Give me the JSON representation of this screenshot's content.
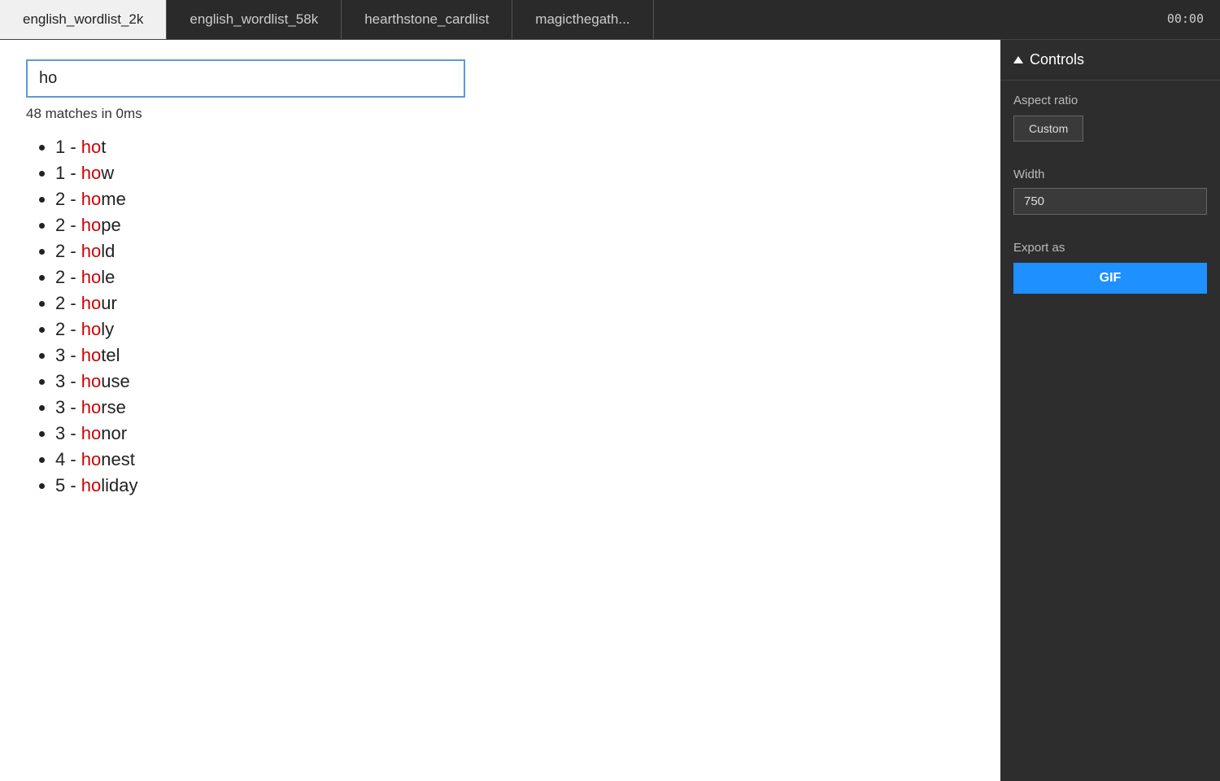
{
  "timer": "00:00",
  "tabs": [
    {
      "id": "tab-wordlist-2k",
      "label": "english_wordlist_2k",
      "active": true
    },
    {
      "id": "tab-wordlist-58k",
      "label": "english_wordlist_58k",
      "active": false
    },
    {
      "id": "tab-hearthstone",
      "label": "hearthstone_cardlist",
      "active": false
    },
    {
      "id": "tab-magic",
      "label": "magicthegath...",
      "active": false
    }
  ],
  "search": {
    "value": "ho",
    "placeholder": ""
  },
  "match_info": "48 matches in 0ms",
  "results": [
    {
      "number": "1",
      "highlight": "ho",
      "rest": "t"
    },
    {
      "number": "1",
      "highlight": "ho",
      "rest": "w"
    },
    {
      "number": "2",
      "highlight": "ho",
      "rest": "me"
    },
    {
      "number": "2",
      "highlight": "ho",
      "rest": "pe"
    },
    {
      "number": "2",
      "highlight": "ho",
      "rest": "ld"
    },
    {
      "number": "2",
      "highlight": "ho",
      "rest": "le"
    },
    {
      "number": "2",
      "highlight": "ho",
      "rest": "ur"
    },
    {
      "number": "2",
      "highlight": "ho",
      "rest": "ly"
    },
    {
      "number": "3",
      "highlight": "ho",
      "rest": "tel"
    },
    {
      "number": "3",
      "highlight": "ho",
      "rest": "use"
    },
    {
      "number": "3",
      "highlight": "ho",
      "rest": "rse"
    },
    {
      "number": "3",
      "highlight": "ho",
      "rest": "nor"
    },
    {
      "number": "4",
      "highlight": "ho",
      "rest": "nest"
    },
    {
      "number": "5",
      "highlight": "ho",
      "rest": "liday"
    }
  ],
  "controls": {
    "header": "Controls",
    "aspect_ratio_label": "Aspect ratio",
    "custom_button_label": "Custom",
    "width_label": "Width",
    "width_value": "750",
    "export_label": "Export as",
    "gif_button_label": "GIF"
  }
}
